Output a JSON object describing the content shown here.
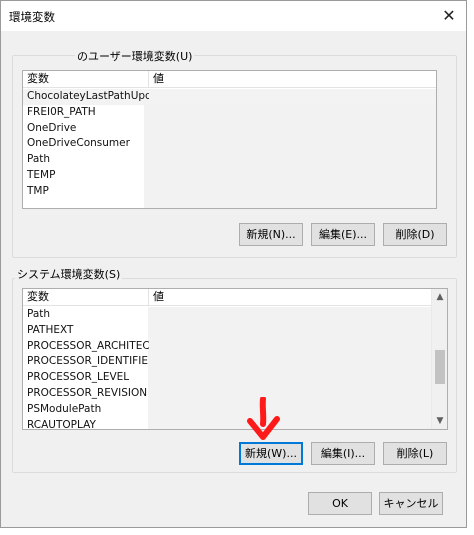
{
  "window": {
    "title": "環境変数",
    "close_glyph": "✕"
  },
  "user_vars": {
    "label": "のユーザー環境変数(U)",
    "columns": {
      "name": "変数",
      "value": "値"
    },
    "rows": [
      {
        "name": "ChocolateyLastPathUpdate"
      },
      {
        "name": "FREI0R_PATH"
      },
      {
        "name": "OneDrive"
      },
      {
        "name": "OneDriveConsumer"
      },
      {
        "name": "Path"
      },
      {
        "name": "TEMP"
      },
      {
        "name": "TMP"
      }
    ],
    "buttons": {
      "new": "新規(N)...",
      "edit": "編集(E)...",
      "delete": "削除(D)"
    }
  },
  "system_vars": {
    "label": "システム環境変数(S)",
    "columns": {
      "name": "変数",
      "value": "値"
    },
    "rows": [
      {
        "name": "Path"
      },
      {
        "name": "PATHEXT"
      },
      {
        "name": "PROCESSOR_ARCHITECTURE"
      },
      {
        "name": "PROCESSOR_IDENTIFIER"
      },
      {
        "name": "PROCESSOR_LEVEL"
      },
      {
        "name": "PROCESSOR_REVISION"
      },
      {
        "name": "PSModulePath"
      },
      {
        "name": "RCAUTOPLAY"
      }
    ],
    "buttons": {
      "new": "新規(W)...",
      "edit": "編集(I)...",
      "delete": "削除(L)"
    }
  },
  "dialog_buttons": {
    "ok": "OK",
    "cancel": "キャンセル"
  },
  "colors": {
    "annotation_arrow": "#ff1a1a",
    "focus_border": "#0078d7"
  }
}
